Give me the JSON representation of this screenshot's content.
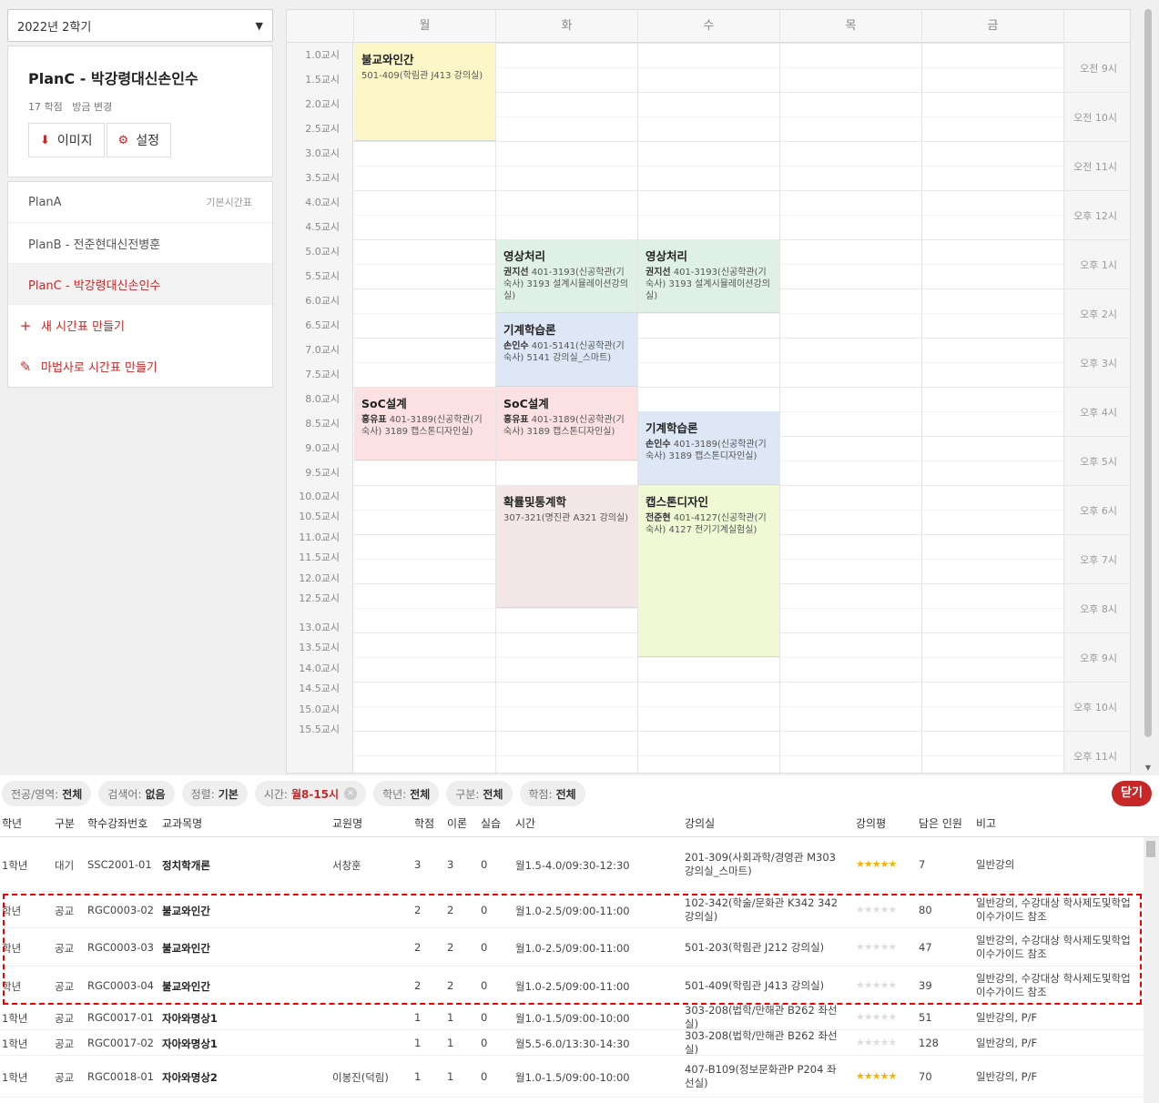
{
  "semester": "2022년 2학기",
  "plan_card": {
    "title": "PlanC - 박강령대신손인수",
    "credits": "17 학점",
    "updated": "방금 변경",
    "image_btn": "이미지",
    "settings_btn": "설정"
  },
  "plans": [
    {
      "label": "PlanA",
      "tag": "기본시간표"
    },
    {
      "label": "PlanB - 전준현대신전병훈",
      "tag": ""
    },
    {
      "label": "PlanC - 박강령대신손인수",
      "tag": ""
    }
  ],
  "actions": {
    "new_table": "새 시간표 만들기",
    "wizard": "마법사로 시간표 만들기"
  },
  "days": [
    "월",
    "화",
    "수",
    "목",
    "금"
  ],
  "periods": [
    "1.0교시",
    "1.5교시",
    "2.0교시",
    "2.5교시",
    "3.0교시",
    "3.5교시",
    "4.0교시",
    "4.5교시",
    "5.0교시",
    "5.5교시",
    "6.0교시",
    "6.5교시",
    "7.0교시",
    "7.5교시",
    "8.0교시",
    "8.5교시",
    "9.0교시",
    "9.5교시",
    "10.0교시",
    "10.5교시",
    "11.0교시",
    "11.5교시",
    "12.0교시",
    "12.5교시",
    "13.0교시",
    "13.5교시",
    "14.0교시",
    "14.5교시",
    "15.0교시",
    "15.5교시"
  ],
  "hours": [
    "오전 9시",
    "오전 10시",
    "오전 11시",
    "오후 12시",
    "오후 1시",
    "오후 2시",
    "오후 3시",
    "오후 4시",
    "오후 5시",
    "오후 6시",
    "오후 7시",
    "오후 8시",
    "오후 9시",
    "오후 10시",
    "오후 11시"
  ],
  "courses": [
    {
      "name": "불교와인간",
      "prof": "",
      "info": "501-409(학림관 J413 강의실)",
      "day": 0,
      "start": 9.0,
      "end": 11.0,
      "color": "#fdf7c8"
    },
    {
      "name": "영상처리",
      "prof": "권지선",
      "info": "401-3193(신공학관(기숙사) 3193 설계시뮬레이션강의실)",
      "day": 1,
      "start": 13.0,
      "end": 14.5,
      "color": "#dff1e7"
    },
    {
      "name": "영상처리",
      "prof": "권지선",
      "info": "401-3193(신공학관(기숙사) 3193 설계시뮬레이션강의실)",
      "day": 2,
      "start": 13.0,
      "end": 14.5,
      "color": "#dff1e7"
    },
    {
      "name": "기계학습론",
      "prof": "손인수",
      "info": "401-5141(신공학관(기숙사) 5141 강의실_스마트)",
      "day": 1,
      "start": 14.5,
      "end": 16.0,
      "color": "#dde7f6"
    },
    {
      "name": "SoC설계",
      "prof": "홍유표",
      "info": "401-3189(신공학관(기숙사) 3189 캡스톤디자인실)",
      "day": 0,
      "start": 16.0,
      "end": 17.5,
      "color": "#fbe1e1"
    },
    {
      "name": "SoC설계",
      "prof": "홍유표",
      "info": "401-3189(신공학관(기숙사) 3189 캡스톤디자인실)",
      "day": 1,
      "start": 16.0,
      "end": 17.5,
      "color": "#fbe1e1"
    },
    {
      "name": "기계학습론",
      "prof": "손인수",
      "info": "401-3189(신공학관(기숙사) 3189 캡스톤디자인실)",
      "day": 2,
      "start": 16.5,
      "end": 18.0,
      "color": "#dde7f6"
    },
    {
      "name": "확률및통계학",
      "prof": "",
      "info": "307-321(명진관 A321 강의실)",
      "day": 1,
      "start": 18.0,
      "end": 20.5,
      "color": "#f3e6e6"
    },
    {
      "name": "캡스톤디자인",
      "prof": "전준현",
      "info": "401-4127(신공학관(기숙사) 4127 전기기계실험실)",
      "day": 2,
      "start": 18.0,
      "end": 21.5,
      "color": "#f0f8d4"
    }
  ],
  "filters": [
    {
      "label": "전공/영역:",
      "value": "전체"
    },
    {
      "label": "검색어:",
      "value": "없음"
    },
    {
      "label": "정렬:",
      "value": "기본"
    },
    {
      "label": "시간:",
      "value": "월8-15시"
    },
    {
      "label": "학년:",
      "value": "전체"
    },
    {
      "label": "구분:",
      "value": "전체"
    },
    {
      "label": "학점:",
      "value": "전체"
    }
  ],
  "close_label": "닫기",
  "table_headers": [
    "학년",
    "구분",
    "학수강좌번호",
    "교과목명",
    "교원명",
    "학점",
    "이론",
    "실습",
    "시간",
    "강의실",
    "강의평",
    "담은 인원",
    "비고"
  ],
  "rows": [
    {
      "year": "1학년",
      "type": "대기",
      "code": "SSC2001-01",
      "title": "정치학개론",
      "prof": "서창훈",
      "credit": "3",
      "theory": "3",
      "practice": "0",
      "time": "월1.5-4.0/09:30-12:30",
      "room": "201-309(사회과학/경영관 M303 강의실_스마트)",
      "rating": 5,
      "count": "7",
      "note": "일반강의"
    },
    {
      "year": "학년",
      "type": "공교",
      "code": "RGC0003-02",
      "title": "불교와인간",
      "prof": "",
      "credit": "2",
      "theory": "2",
      "practice": "0",
      "time": "월1.0-2.5/09:00-11:00",
      "room": "102-342(학술/문화관 K342 342 강의실)",
      "rating": 0,
      "count": "80",
      "note": "일반강의, 수강대상 학사제도및학업이수가이드 참조"
    },
    {
      "year": "학년",
      "type": "공교",
      "code": "RGC0003-03",
      "title": "불교와인간",
      "prof": "",
      "credit": "2",
      "theory": "2",
      "practice": "0",
      "time": "월1.0-2.5/09:00-11:00",
      "room": "501-203(학림관 J212 강의실)",
      "rating": 0,
      "count": "47",
      "note": "일반강의, 수강대상 학사제도및학업이수가이드 참조"
    },
    {
      "year": "학년",
      "type": "공교",
      "code": "RGC0003-04",
      "title": "불교와인간",
      "prof": "",
      "credit": "2",
      "theory": "2",
      "practice": "0",
      "time": "월1.0-2.5/09:00-11:00",
      "room": "501-409(학림관 J413 강의실)",
      "rating": 0,
      "count": "39",
      "note": "일반강의, 수강대상 학사제도및학업이수가이드 참조"
    },
    {
      "year": "1학년",
      "type": "공교",
      "code": "RGC0017-01",
      "title": "자아와명상1",
      "prof": "",
      "credit": "1",
      "theory": "1",
      "practice": "0",
      "time": "월1.0-1.5/09:00-10:00",
      "room": "303-208(법학/만해관 B262 좌선실)",
      "rating": 0,
      "count": "51",
      "note": "일반강의, P/F"
    },
    {
      "year": "1학년",
      "type": "공교",
      "code": "RGC0017-02",
      "title": "자아와명상1",
      "prof": "",
      "credit": "1",
      "theory": "1",
      "practice": "0",
      "time": "월5.5-6.0/13:30-14:30",
      "room": "303-208(법학/만해관 B262 좌선실)",
      "rating": 0,
      "count": "128",
      "note": "일반강의, P/F"
    },
    {
      "year": "1학년",
      "type": "공교",
      "code": "RGC0018-01",
      "title": "자아와명상2",
      "prof": "이봉진(덕림)",
      "credit": "1",
      "theory": "1",
      "practice": "0",
      "time": "월1.0-1.5/09:00-10:00",
      "room": "407-B109(정보문화관P P204 좌선실)",
      "rating": 5,
      "count": "70",
      "note": "일반강의, P/F"
    }
  ]
}
